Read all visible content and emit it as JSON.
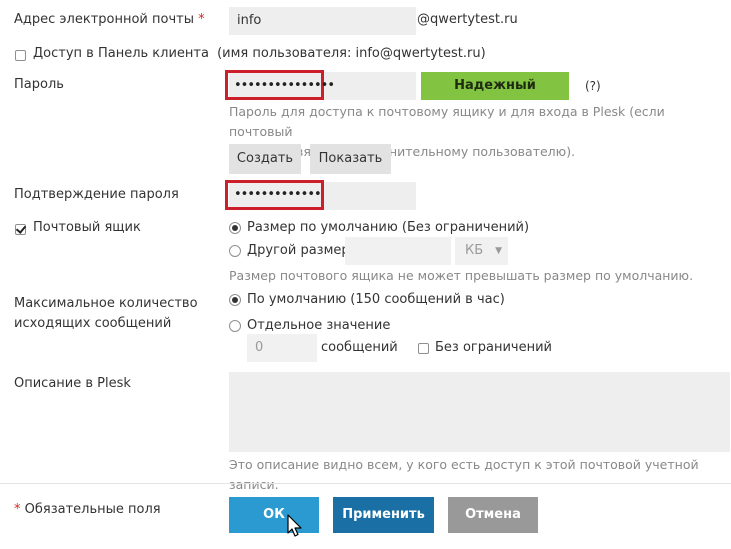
{
  "email": {
    "label": "Адрес электронной почты",
    "required_mark": "*",
    "value": "info",
    "domain": "@qwertytest.ru"
  },
  "panel_access": {
    "label": "Доступ в Панель клиента",
    "note": "(имя пользователя: info@qwertytest.ru)",
    "checked": false
  },
  "password": {
    "label": "Пароль",
    "value_masked": "•••••••••••••••",
    "strength": "Надежный",
    "help_link": "(?)",
    "hint_line1": "Пароль для доступа к почтовому ящику и для входа в Plesk (если почтовый",
    "hint_line2": "адрес привязан к дополнительному пользователю).",
    "generate_button": "Создать",
    "show_button": "Показать"
  },
  "confirm_password": {
    "label": "Подтверждение пароля",
    "value_masked": "•••••••••••••"
  },
  "mailbox": {
    "label": "Почтовый ящик",
    "checked": true,
    "option_default": "Размер по умолчанию (Без ограничений)",
    "option_custom": "Другой размер",
    "size_value": "",
    "unit": "КБ",
    "hint": "Размер почтового ящика не может превышать размер по умолчанию."
  },
  "outgoing": {
    "label_line1": "Максимальное количество",
    "label_line2": "исходящих сообщений",
    "option_default": "По умолчанию (150 сообщений в час)",
    "option_custom": "Отдельное значение",
    "custom_value": "0",
    "custom_unit": "сообщений",
    "unlimited_label": "Без ограничений"
  },
  "description": {
    "label": "Описание в Plesk",
    "value": "",
    "hint": "Это описание видно всем, у кого есть доступ к этой почтовой учетной записи."
  },
  "footer": {
    "required_mark": "*",
    "required_note": "Обязательные поля",
    "ok_button": "ОК",
    "apply_button": "Применить",
    "cancel_button": "Отмена"
  },
  "colors": {
    "ok": "#2b9ad1",
    "apply": "#1a70a4",
    "cancel": "#999999",
    "strength": "#82c341",
    "highlight": "#cc1f2b"
  }
}
